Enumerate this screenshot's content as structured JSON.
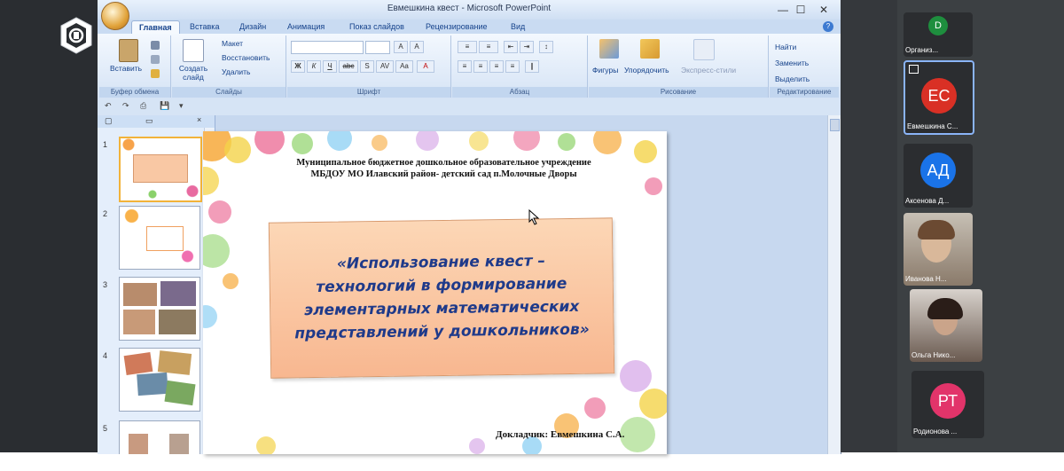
{
  "window": {
    "title": "Евмешкина квест - Microsoft PowerPoint",
    "minimize": "—",
    "maximize": "☐",
    "close": "✕"
  },
  "ribbon": {
    "tabs": [
      "Главная",
      "Вставка",
      "Дизайн",
      "Анимация",
      "Показ слайдов",
      "Рецензирование",
      "Вид"
    ],
    "clipboard": {
      "paste": "Вставить",
      "label": "Буфер обмена"
    },
    "slides": {
      "new_slide": "Создать слайд",
      "layout": "Макет",
      "reset": "Восстановить",
      "delete": "Удалить",
      "label": "Слайды"
    },
    "font": {
      "label": "Шрифт",
      "bold": "Ж",
      "italic": "К",
      "underline": "Ч",
      "strike": "abc",
      "shadow": "S",
      "spacing": "AV",
      "case": "Aa",
      "grow": "A",
      "shrink": "A"
    },
    "paragraph": {
      "label": "Абзац"
    },
    "drawing": {
      "shapes": "Фигуры",
      "arrange": "Упорядочить",
      "quick_styles": "Экспресс-стили",
      "label": "Рисование"
    },
    "editing": {
      "find": "Найти",
      "replace": "Заменить",
      "select": "Выделить",
      "label": "Редактирование"
    }
  },
  "qat": {
    "undo": "↶",
    "redo": "↷",
    "save": "💾"
  },
  "thumbnails": [
    "1",
    "2",
    "3",
    "4",
    "5"
  ],
  "slide": {
    "institution_line1": "Муниципальное бюджетное дошкольное образовательное учреждение",
    "institution_line2": "МБДОУ МО Илавский район- детский сад п.Молочные Дворы",
    "title_line1": "«Использование квест –",
    "title_line2": "технологий в  формирование",
    "title_line3": "элементарных математических",
    "title_line4": "представлений у дошкольников»",
    "reporter": "Докладчик: Евмешкина С.А."
  },
  "participants": [
    {
      "initials": "D",
      "name": "Организ...",
      "color": "#1e8e3e"
    },
    {
      "initials": "ЕС",
      "name": "Евмешкина С...",
      "color": "#d93025"
    },
    {
      "initials": "АД",
      "name": "Аксенова Д...",
      "color": "#1a73e8"
    },
    {
      "initials": "",
      "name": "Иванова Н...",
      "color": "#8a7a6a"
    },
    {
      "initials": "",
      "name": "Ольга Нико...",
      "color": "#6a5a50"
    },
    {
      "initials": "РТ",
      "name": "Родионова ...",
      "color": "#e2346a"
    }
  ]
}
